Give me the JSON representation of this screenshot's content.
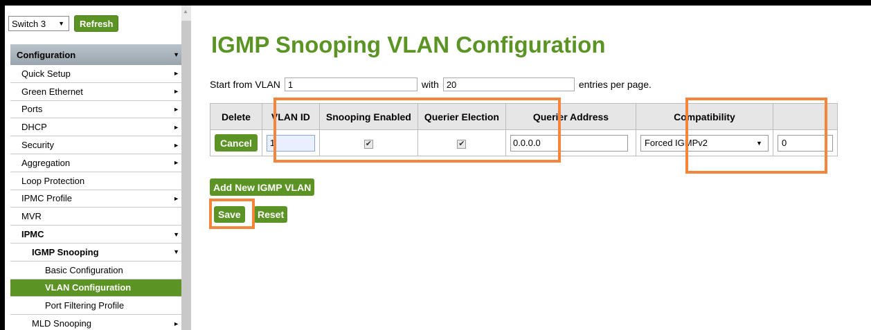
{
  "sidebar": {
    "switch_select": "Switch 3",
    "refresh_label": "Refresh",
    "config_header": "Configuration",
    "items": [
      {
        "label": "Quick Setup",
        "level": 0,
        "arrow": "►"
      },
      {
        "label": "Green Ethernet",
        "level": 0,
        "arrow": "►"
      },
      {
        "label": "Ports",
        "level": 0,
        "arrow": "►"
      },
      {
        "label": "DHCP",
        "level": 0,
        "arrow": "►"
      },
      {
        "label": "Security",
        "level": 0,
        "arrow": "►"
      },
      {
        "label": "Aggregation",
        "level": 0,
        "arrow": "►"
      },
      {
        "label": "Loop Protection",
        "level": 0,
        "arrow": ""
      },
      {
        "label": "IPMC Profile",
        "level": 0,
        "arrow": "►"
      },
      {
        "label": "MVR",
        "level": 0,
        "arrow": ""
      },
      {
        "label": "IPMC",
        "level": 0,
        "arrow": "▼",
        "bold": true
      },
      {
        "label": "IGMP Snooping",
        "level": 1,
        "arrow": "▼",
        "bold": true
      },
      {
        "label": "Basic Configuration",
        "level": 2,
        "arrow": ""
      },
      {
        "label": "VLAN Configuration",
        "level": 2,
        "arrow": "",
        "active": true
      },
      {
        "label": "Port Filtering Profile",
        "level": 2,
        "arrow": ""
      },
      {
        "label": "MLD Snooping",
        "level": 1,
        "arrow": "►"
      }
    ]
  },
  "main": {
    "title": "IGMP Snooping VLAN Configuration",
    "start_label": "Start from VLAN",
    "start_value": "1",
    "with_label": "with",
    "with_value": "20",
    "entries_label": "entries per page.",
    "table": {
      "headers": [
        "Delete",
        "VLAN ID",
        "Snooping Enabled",
        "Querier Election",
        "Querier Address",
        "Compatibility"
      ],
      "row": {
        "cancel_label": "Cancel",
        "vlan_id": "1",
        "snooping_enabled": "✔",
        "querier_election": "✔",
        "querier_address": "0.0.0.0",
        "compatibility": "Forced IGMPv2",
        "extra_value": "0"
      }
    },
    "add_label": "Add New IGMP VLAN",
    "save_label": "Save",
    "reset_label": "Reset"
  },
  "colors": {
    "accent": "#5b9424",
    "highlight": "#f4853a"
  }
}
